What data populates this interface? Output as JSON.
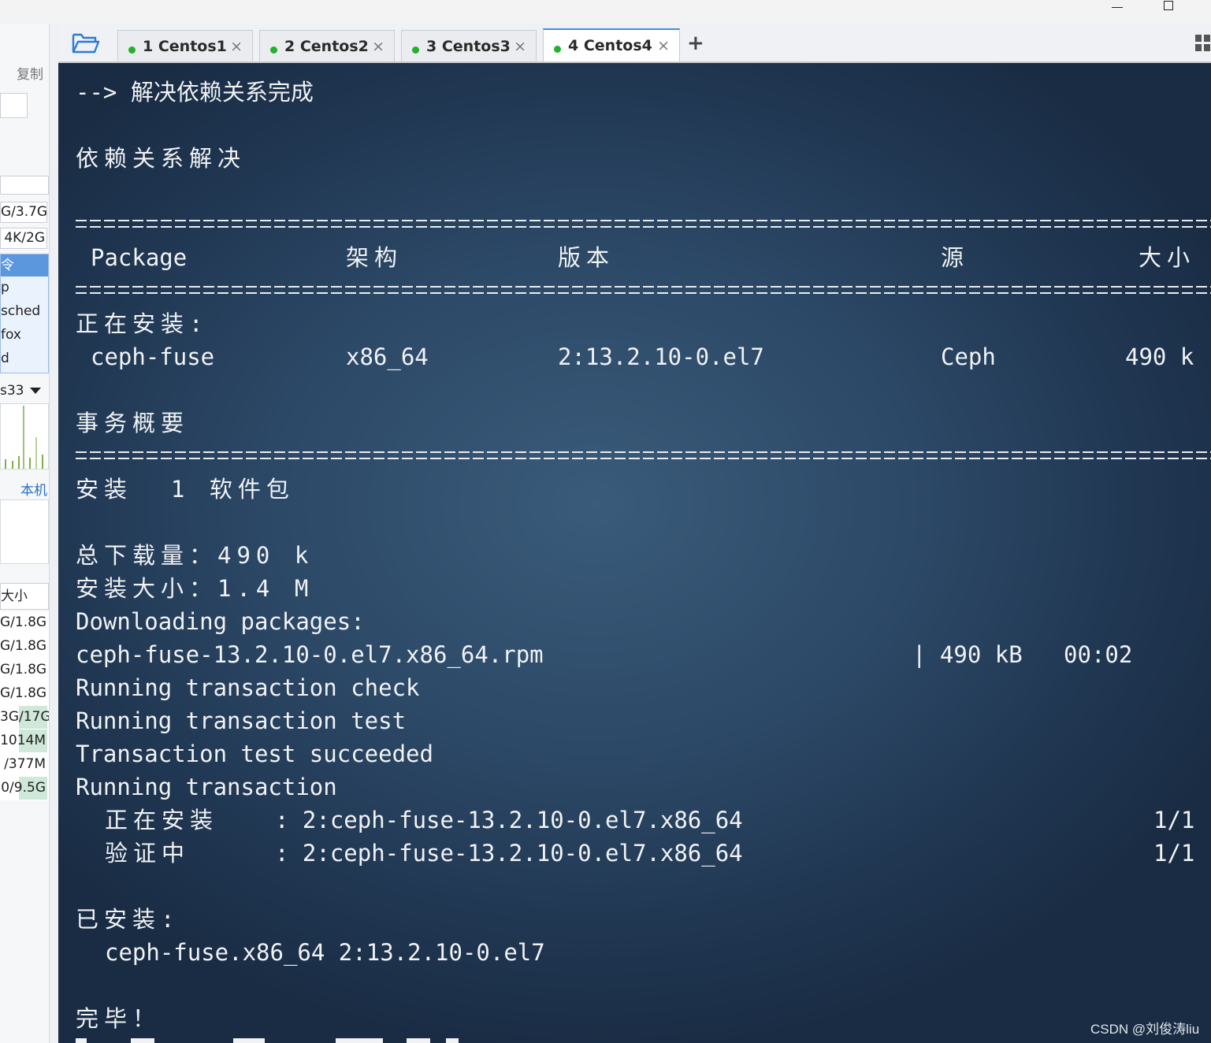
{
  "sidebar": {
    "copy_label": "复制",
    "mem_row1": "G/3.7G",
    "mem_row2": "4K/2G",
    "proc_row1": "令",
    "proc_row2": "p",
    "proc_row3": "sched",
    "proc_row4": "fox",
    "proc_row5": "d",
    "net_iface": "s33",
    "local_label": "本机",
    "size_header": "大小",
    "disk_rows": [
      "G/1.8G",
      "G/1.8G",
      "G/1.8G",
      "G/1.8G",
      "3G/17G",
      "1014M",
      "/377M",
      "0/9.5G"
    ]
  },
  "tabs": [
    {
      "label": "1 Centos1",
      "active": false
    },
    {
      "label": "2 Centos2",
      "active": false
    },
    {
      "label": "3 Centos3",
      "active": false
    },
    {
      "label": "4 Centos4",
      "active": true
    }
  ],
  "add_tab_label": "+",
  "close_glyph": "×",
  "terminal": {
    "l01": "--> 解决依赖关系完成",
    "l02": "依赖关系解决",
    "hdr_package": "Package",
    "hdr_arch": "架构",
    "hdr_version": "版本",
    "hdr_repo": "源",
    "hdr_size": "大小",
    "installing_label": "正在安装:",
    "pkg_name": "ceph-fuse",
    "pkg_arch": "x86_64",
    "pkg_version": "2:13.2.10-0.el7",
    "pkg_repo": "Ceph",
    "pkg_size": "490 k",
    "summary_label": "事务概要",
    "install_count": "安装  1 软件包",
    "total_download": "总下载量：490 k",
    "install_size": "安装大小：1.4 M",
    "downloading": "Downloading packages:",
    "rpm_file": "ceph-fuse-13.2.10-0.el7.x86_64.rpm",
    "rpm_progress": "| 490 kB   00:02",
    "check": "Running transaction check",
    "test": "Running transaction test",
    "test_ok": "Transaction test succeeded",
    "running": "Running transaction",
    "step1_label": "正在安装",
    "step1_pkg": ": 2:ceph-fuse-13.2.10-0.el7.x86_64",
    "step1_count": "1/1",
    "step2_label": "验证中",
    "step2_pkg": ": 2:ceph-fuse-13.2.10-0.el7.x86_64",
    "step2_count": "1/1",
    "installed_label": "已安装:",
    "installed_pkg": "ceph-fuse.x86_64 2:13.2.10-0.el7",
    "done": "完毕！"
  },
  "watermark": "CSDN @刘俊涛liu"
}
